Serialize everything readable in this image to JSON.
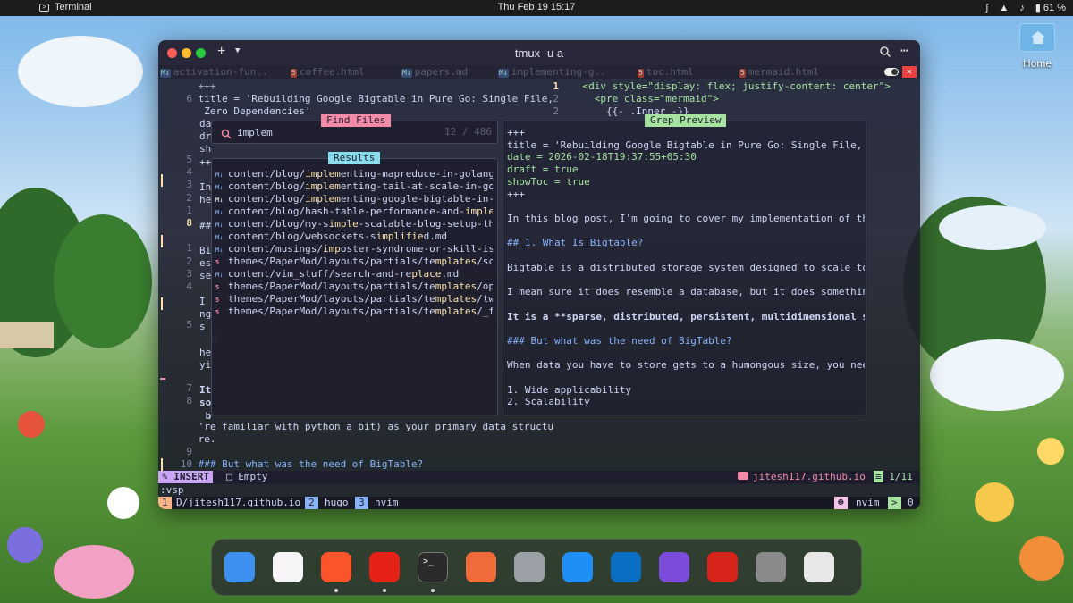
{
  "topbar": {
    "app_name": "Terminal",
    "datetime": "Thu Feb 19  15:17",
    "battery": "61 %"
  },
  "desktop": {
    "home_label": "Home"
  },
  "window": {
    "title": "tmux -u a"
  },
  "buffer_tabs": [
    {
      "label": "activation-fun..",
      "icon": "md"
    },
    {
      "label": "coffee.html",
      "icon": "html"
    },
    {
      "label": "papers.md",
      "icon": "md"
    },
    {
      "label": "implementing-g..",
      "icon": "md"
    },
    {
      "label": "toc.html",
      "icon": "html"
    },
    {
      "label": "mermaid.html",
      "icon": "html"
    }
  ],
  "left_pane": {
    "top": [
      {
        "num": "",
        "text": "+++"
      },
      {
        "num": "6",
        "text": "title = 'Rebuilding Google Bigtable in Pure Go: Single File,"
      },
      {
        "num": "",
        "text": " Zero Dependencies'"
      }
    ],
    "gutter": [
      "5",
      "4",
      "3",
      "2",
      "1",
      "8",
      "",
      "1",
      "2",
      "3",
      "4",
      "",
      "",
      "5",
      "",
      "",
      "",
      "",
      "7",
      "8"
    ],
    "text_peek": [
      "da",
      "dr",
      "sh",
      "++",
      "",
      "In",
      "he",
      "",
      "##",
      "",
      "Bi",
      "es",
      "se",
      "",
      "I",
      "ng",
      "s",
      "  d",
      "he",
      "yi",
      "",
      "It",
      "so",
      " b"
    ],
    "bottom": [
      {
        "num": "",
        "text": "'re familiar with python a bit) as your primary data structu"
      },
      {
        "num": "",
        "text": "re."
      },
      {
        "num": "9",
        "text": ""
      },
      {
        "num": "10",
        "text": "### But what was the need of BigTable?"
      }
    ]
  },
  "right_pane": {
    "lines": [
      {
        "num": "1",
        "text": "<div style=\"display: flex; justify-content: center\">"
      },
      {
        "num": "2",
        "text": "  <pre class=\"mermaid\">"
      },
      {
        "num": "2",
        "text": "    {{- .Inner -}}"
      }
    ]
  },
  "find_files": {
    "title": "Find Files",
    "query": "implem",
    "counter": "12 / 486",
    "results_title": "Results",
    "results": [
      {
        "pre": "content/blog/",
        "match": "implem",
        "post": "enting-mapreduce-in-golang.m",
        "icon": "md"
      },
      {
        "pre": "content/blog/",
        "match": "implem",
        "post": "enting-tail-at-scale-in-gola",
        "icon": "md"
      },
      {
        "pre": "content/blog/",
        "match": "implem",
        "post": "enting-google-bigtable-in-go",
        "icon": "md"
      },
      {
        "pre": "content/blog/hash-table-performance-and-",
        "match": "impleme",
        "post": "",
        "icon": "md"
      },
      {
        "pre": "content/blog/my-s",
        "match": "imple",
        "post": "-scalable-blog-setup-that",
        "icon": "md"
      },
      {
        "pre": "content/blog/websockets-s",
        "match": "implifie",
        "post": "d.md",
        "icon": "md"
      },
      {
        "pre": "content/musings/",
        "match": "imp",
        "post": "oster-syndrome-or-skill-issu",
        "icon": "md"
      },
      {
        "pre": "themes/PaperMod/layouts/partials/te",
        "match": "mplates",
        "post": "/sche",
        "icon": "html"
      },
      {
        "pre": "content/vim_stuff/search-and-re",
        "match": "place",
        "post": ".md",
        "icon": "md"
      },
      {
        "pre": "themes/PaperMod/layouts/partials/te",
        "match": "mplates",
        "post": "/open",
        "icon": "html"
      },
      {
        "pre": "themes/PaperMod/layouts/partials/te",
        "match": "mplates",
        "post": "/twit",
        "icon": "html"
      },
      {
        "pre": "themes/PaperMod/layouts/partials/te",
        "match": "mplates",
        "post": "/_fun",
        "icon": "html"
      }
    ]
  },
  "grep_preview": {
    "title": "Grep Preview",
    "lines": [
      "+++",
      "title = 'Rebuilding Google Bigtable in Pure Go: Single File, Zer",
      "date = 2026-02-18T19:37:55+05:30",
      "draft = true",
      "showToc = true",
      "+++",
      "",
      "In this blog post, I'm going to cover my implementation of the [",
      "",
      "## 1. What Is Bigtable?",
      "",
      "Bigtable is a distributed storage system designed to scale to pe",
      "",
      "I mean sure it does resemble a database, but it does something d",
      "",
      "It is a **sparse, distributed, persistent, multidimensional sort",
      "",
      "### But what was the need of BigTable?",
      "",
      "When data you have to store gets to a humongous size, you need c",
      "",
      "1. Wide applicability",
      "2. Scalability"
    ]
  },
  "statusline": {
    "mode": "INSERT",
    "buffer_state": "Empty",
    "repo": "jitesh117.github.io",
    "position": "1/11"
  },
  "cmdline": ":vsp",
  "tmux": {
    "windows": [
      {
        "index": "1",
        "name": "D/jitesh117.github.io"
      },
      {
        "index": "2",
        "name": "hugo"
      },
      {
        "index": "3",
        "name": "nvim"
      }
    ],
    "right_name": "nvim",
    "right_count": "0"
  },
  "dock": [
    "Finder",
    "Chrome",
    "Brave",
    "YouTube Music",
    "Terminal",
    "Paw",
    "System Settings",
    "App Store",
    "VS Code",
    "Obsidian",
    "Acrobat",
    "Trash",
    "Launchpad"
  ],
  "colors": {
    "accent_red": "#f38ba8",
    "accent_green": "#a6e3a1",
    "accent_blue": "#89dceb",
    "accent_purple": "#cba6f7",
    "accent_yellow": "#f9e2af"
  }
}
